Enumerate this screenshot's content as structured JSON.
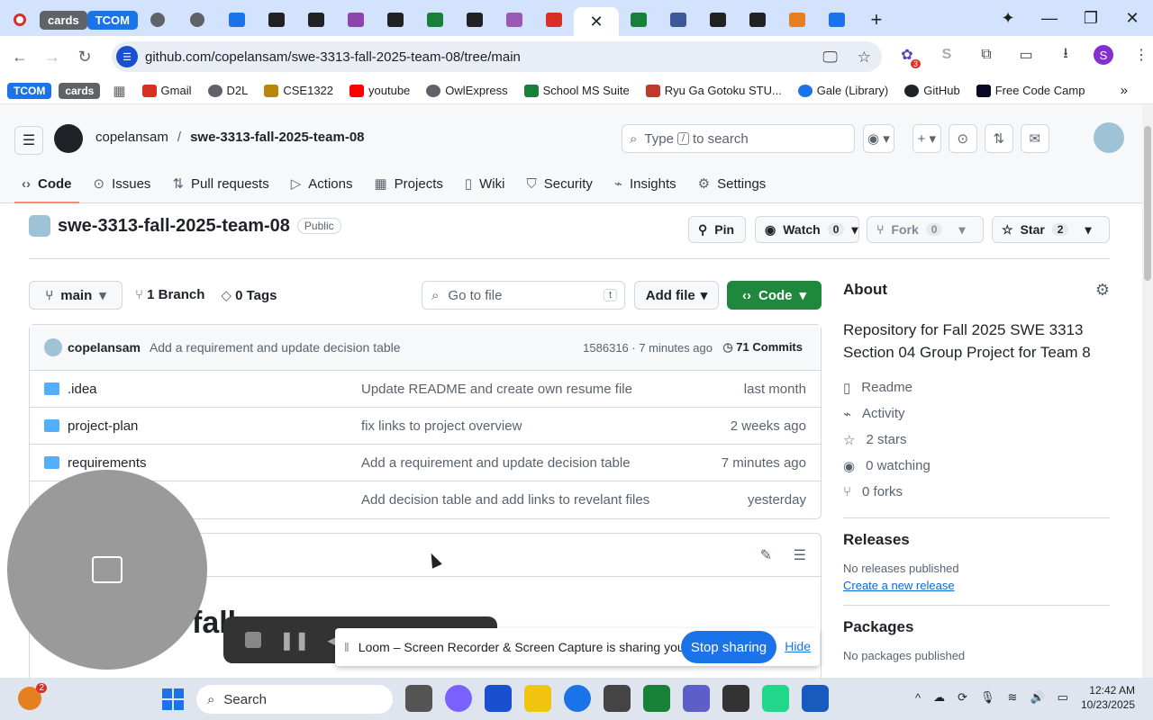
{
  "browser": {
    "tab_chips": [
      "cards",
      "TCOM"
    ],
    "url": "github.com/copelansam/swe-3313-fall-2025-team-08/tree/main",
    "ext_badge": "3",
    "profile_initial": "S"
  },
  "bookmarks": {
    "chips": [
      "TCOM",
      "cards"
    ],
    "items": [
      "Gmail",
      "D2L",
      "CSE1322",
      "youtube",
      "OwlExpress",
      "School MS Suite",
      "Ryu Ga Gotoku STU...",
      "Gale (Library)",
      "GitHub",
      "Free Code Camp"
    ]
  },
  "github": {
    "owner": "copelansam",
    "repo": "swe-3313-fall-2025-team-08",
    "search_placeholder_pre": "Type",
    "search_key": "/",
    "search_placeholder_post": "to search",
    "nav": [
      "Code",
      "Issues",
      "Pull requests",
      "Actions",
      "Projects",
      "Wiki",
      "Security",
      "Insights",
      "Settings"
    ],
    "visibility": "Public",
    "pin_label": "Pin",
    "watch_label": "Watch",
    "watch_count": "0",
    "fork_label": "Fork",
    "fork_count": "0",
    "star_label": "Star",
    "star_count": "2",
    "branch": "main",
    "branch_count": "1 Branch",
    "tags_count": "0 Tags",
    "goto_placeholder": "Go to file",
    "goto_key": "t",
    "add_file": "Add file",
    "code_button": "Code",
    "latest_commit": {
      "author": "copelansam",
      "message": "Add a requirement and update decision table",
      "meta": "1586316 · 7 minutes ago",
      "commits": "71 Commits"
    },
    "files": [
      {
        "name": ".idea",
        "message": "Update README and create own resume file",
        "date": "last month"
      },
      {
        "name": "project-plan",
        "message": "fix links to project overview",
        "date": "2 weeks ago"
      },
      {
        "name": "requirements",
        "message": "Add a requirement and update decision table",
        "date": "7 minutes ago"
      },
      {
        "name": "",
        "message": "Add decision table and add links to revelant files",
        "date": "yesterday"
      }
    ],
    "readme_title_partial": "fall",
    "about": {
      "heading": "About",
      "description": "Repository for Fall 2025 SWE 3313 Section 04 Group Project for Team 8",
      "readme": "Readme",
      "activity": "Activity",
      "stars": "2 stars",
      "watching": "0 watching",
      "forks": "0 forks"
    },
    "releases": {
      "heading": "Releases",
      "none": "No releases published",
      "create": "Create a new release"
    },
    "packages": {
      "heading": "Packages",
      "none": "No packages published"
    }
  },
  "loom": {
    "message": "Loom – Screen Recorder & Screen Capture is sharing your screen.",
    "stop": "Stop sharing",
    "hide": "Hide"
  },
  "taskbar": {
    "search": "Search",
    "notify_badge": "2",
    "time": "12:42 AM",
    "date": "10/23/2025"
  }
}
